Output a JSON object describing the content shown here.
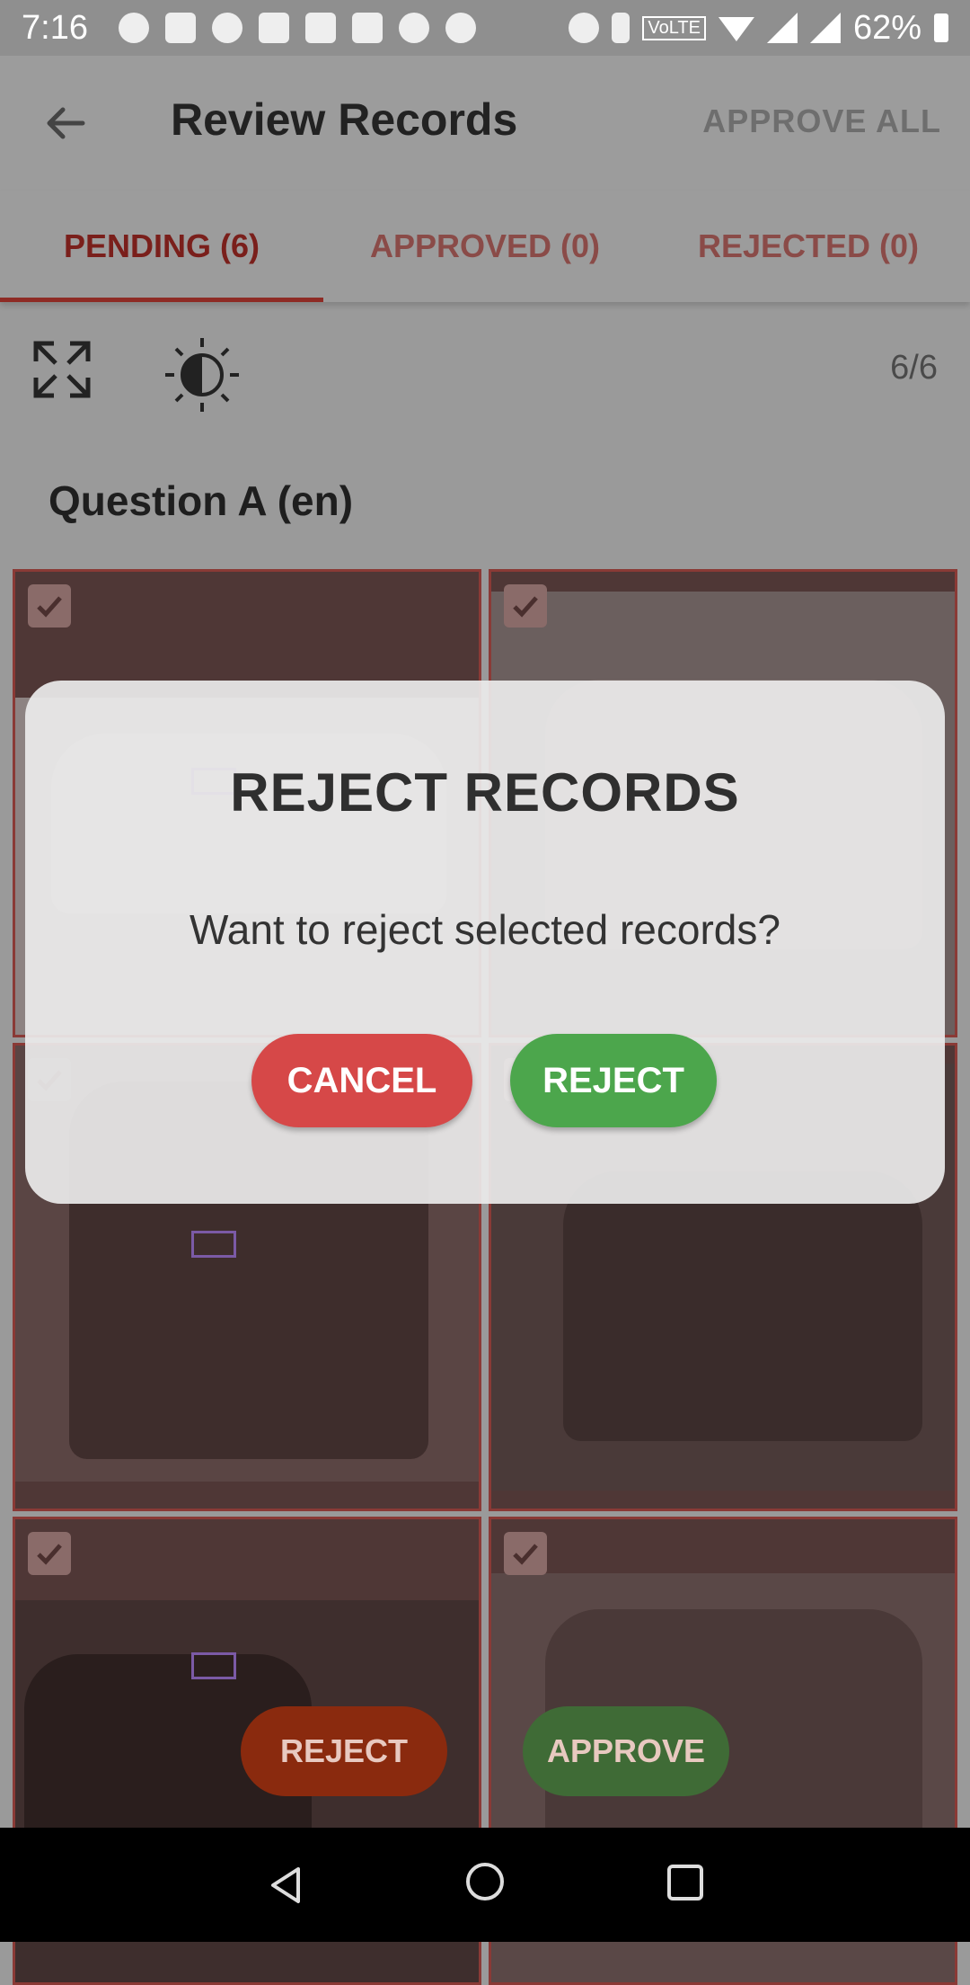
{
  "status_bar": {
    "time": "7:16",
    "volte": "VoLTE",
    "battery": "62%"
  },
  "app_bar": {
    "title": "Review Records",
    "action": "APPROVE ALL"
  },
  "tabs": [
    {
      "label": "PENDING (6)"
    },
    {
      "label": "APPROVED (0)"
    },
    {
      "label": "REJECTED (0)"
    }
  ],
  "toolbar": {
    "counter": "6/6"
  },
  "question": {
    "title": "Question A (en)"
  },
  "dialog": {
    "title": "REJECT RECORDS",
    "message": "Want to reject selected records?",
    "cancel_label": "CANCEL",
    "reject_label": "REJECT"
  },
  "bottom_actions": {
    "reject_label": "REJECT",
    "approve_label": "APPROVE"
  },
  "colors": {
    "accent": "#d32f2f",
    "cancel": "#d64848",
    "confirm": "#4ca64c"
  }
}
